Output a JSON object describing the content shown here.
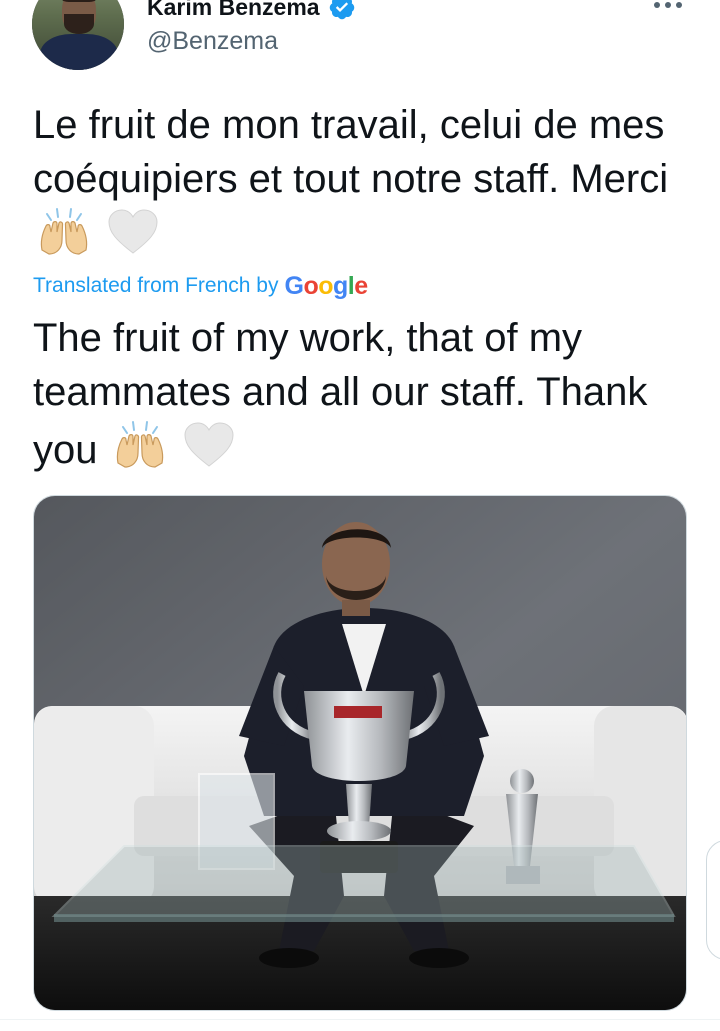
{
  "author": {
    "display_name": "Karim Benzema",
    "handle": "@Benzema",
    "verified": true
  },
  "tweet": {
    "text": "Le fruit de mon travail, celui de mes coéquipiers et tout notre staff. Merci",
    "emojis": [
      "raising-hands-emoji",
      "white-heart-emoji"
    ]
  },
  "translation": {
    "label": "Translated from French by",
    "provider": "Google",
    "text": "The fruit of my work, that of my teammates and all our staff. Thank you"
  },
  "media": {
    "type": "photo"
  },
  "colors": {
    "link": "#1d9bf0",
    "text": "#0f1419",
    "secondary": "#536471",
    "verified": "#1d9bf0"
  },
  "icons": {
    "verified": "verified-badge-icon",
    "more": "more-options-icon"
  }
}
